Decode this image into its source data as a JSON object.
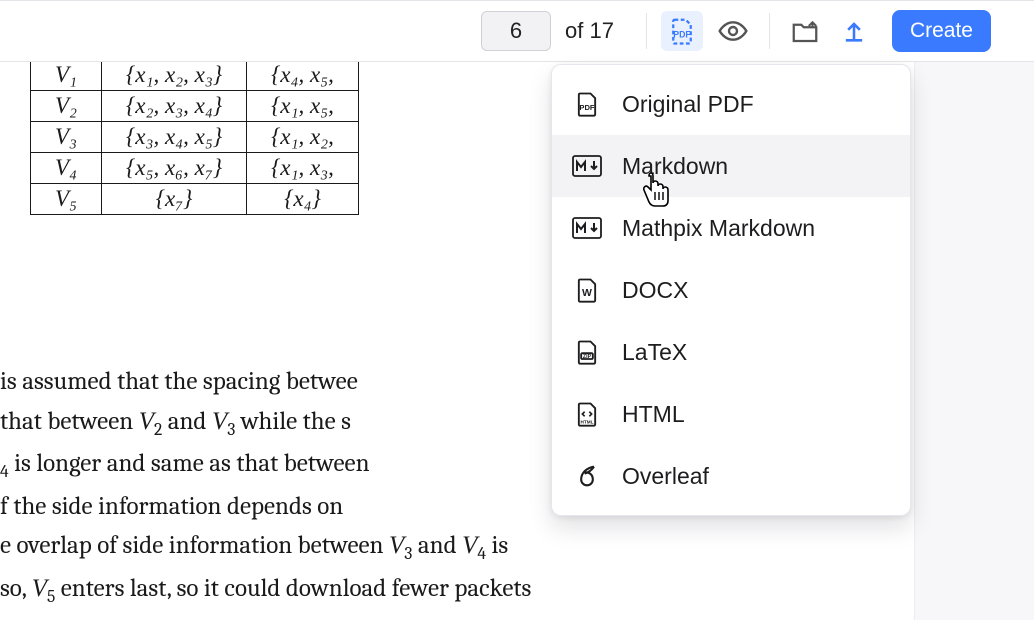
{
  "toolbar": {
    "page_current": "6",
    "page_total": "of 17",
    "create_label": "Create"
  },
  "dropdown": {
    "items": [
      {
        "id": "original-pdf",
        "label": "Original PDF"
      },
      {
        "id": "markdown",
        "label": "Markdown"
      },
      {
        "id": "mathpix-markdown",
        "label": "Mathpix Markdown"
      },
      {
        "id": "docx",
        "label": "DOCX"
      },
      {
        "id": "latex",
        "label": "LaTeX"
      },
      {
        "id": "html",
        "label": "HTML"
      },
      {
        "id": "overleaf",
        "label": "Overleaf"
      }
    ],
    "hovered": "markdown"
  },
  "doc": {
    "table": {
      "rows": [
        [
          "V₁",
          "{x₁, x₂, x₃}",
          "{x₄, x₅,"
        ],
        [
          "V₂",
          "{x₂, x₃, x₄}",
          "{x₁, x₅,"
        ],
        [
          "V₃",
          "{x₃, x₄, x₅}",
          "{x₁, x₂,"
        ],
        [
          "V₄",
          "{x₅, x₆, x₇}",
          "{x₁, x₃,"
        ],
        [
          "V₅",
          "{x₇}",
          "{x₄}"
        ]
      ]
    },
    "body_html": "is assumed that the spacing betwee<br>that between <span class='mi'>V</span><sub>2</sub> and <span class='mi'>V</span><sub>3</sub> while the s<br><sub>4</sub> is longer and same as that between<br>f the side information depends on <br>e overlap of side information between <span class='mi'>V</span><sub>3</sub> and <span class='mi'>V</span><sub>4</sub> is<br>so, <span class='mi'>V</span><sub>5</sub> enters last, so it could download fewer packets"
  }
}
